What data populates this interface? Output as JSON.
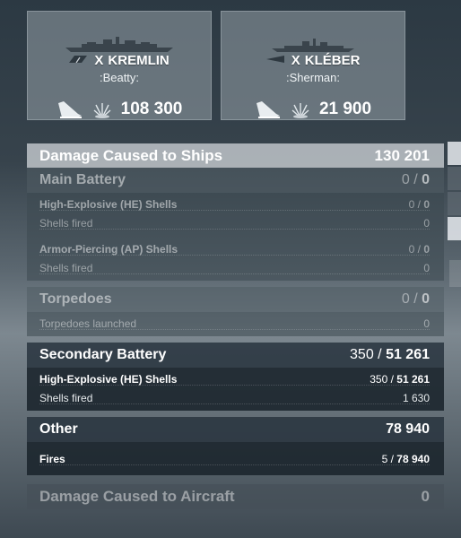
{
  "ships": [
    {
      "tier": "X",
      "name": "KREMLIN",
      "player": ":Beatty:",
      "damage": "108 300",
      "flag_icon": "nation-flag-icon",
      "silhouette_icon": "battleship-silhouette-icon",
      "ribbon_icons": [
        "torpedo-hit-icon",
        "shell-hit-icon"
      ]
    },
    {
      "tier": "X",
      "name": "KLÉBER",
      "player": ":Sherman:",
      "damage": "21 900",
      "flag_icon": "nation-flag-icon",
      "silhouette_icon": "destroyer-silhouette-icon",
      "ribbon_icons": [
        "torpedo-hit-icon",
        "shell-hit-icon"
      ]
    }
  ],
  "damage_ships": {
    "label": "Damage Caused to Ships",
    "value": "130 201"
  },
  "main_battery": {
    "label": "Main Battery",
    "hits": "0",
    "damage": "0",
    "he": {
      "label": "High-Explosive (HE) Shells",
      "hits": "0",
      "damage": "0"
    },
    "he_fired": {
      "label": "Shells fired",
      "value": "0"
    },
    "ap": {
      "label": "Armor-Piercing (AP) Shells",
      "hits": "0",
      "damage": "0"
    },
    "ap_fired": {
      "label": "Shells fired",
      "value": "0"
    }
  },
  "torpedoes": {
    "label": "Torpedoes",
    "hits": "0",
    "damage": "0",
    "launched": {
      "label": "Torpedoes launched",
      "value": "0"
    }
  },
  "secondary": {
    "label": "Secondary Battery",
    "hits": "350",
    "damage": "51 261",
    "he": {
      "label": "High-Explosive (HE) Shells",
      "hits": "350",
      "damage": "51 261"
    },
    "fired": {
      "label": "Shells fired",
      "value": "1 630"
    }
  },
  "other": {
    "label": "Other",
    "value": "78 940",
    "fires": {
      "label": "Fires",
      "hits": "5",
      "damage": "78 940"
    }
  },
  "aircraft": {
    "label": "Damage Caused to Aircraft",
    "value": "0"
  },
  "sep": " / ",
  "colors": {
    "header_bg": "#d2d6da",
    "active_bg": "#28343e",
    "muted_text": "#8a939a"
  }
}
